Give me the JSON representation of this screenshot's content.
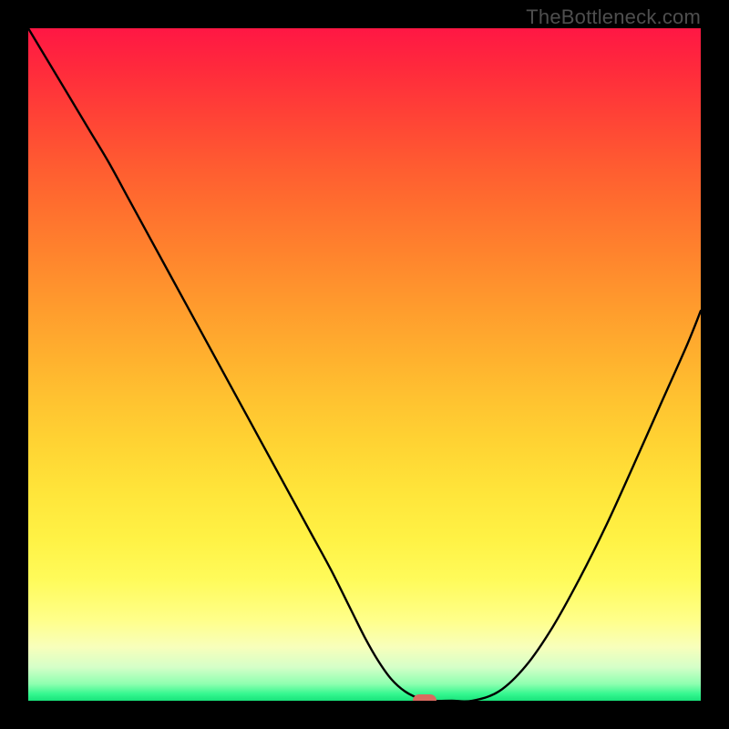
{
  "attribution": "TheBottleneck.com",
  "colors": {
    "background": "#000000",
    "curve_stroke": "#000000",
    "marker_fill": "#d96a5f"
  },
  "chart_data": {
    "type": "line",
    "title": "",
    "xlabel": "",
    "ylabel": "",
    "xlim": [
      0,
      100
    ],
    "ylim": [
      0,
      100
    ],
    "grid": false,
    "legend": false,
    "note": "Axes and tick labels are not shown in the source image; x/y values below are relative to the plot area (0–100). Values are read from the rendered curve.",
    "series": [
      {
        "name": "bottleneck-curve",
        "x": [
          0,
          3,
          6,
          9,
          12,
          15,
          18,
          21,
          24,
          27,
          30,
          33,
          36,
          39,
          42,
          45,
          48,
          50,
          52,
          54,
          56,
          58,
          60,
          63,
          66,
          70,
          74,
          78,
          82,
          86,
          90,
          94,
          98,
          100
        ],
        "y": [
          100,
          95,
          90,
          85,
          80,
          74.5,
          69,
          63.5,
          58,
          52.5,
          47,
          41.5,
          36,
          30.5,
          25,
          19.5,
          13.5,
          9.5,
          6,
          3.2,
          1.4,
          0.4,
          0,
          0,
          0,
          1.4,
          5.2,
          11,
          18.2,
          26.2,
          35,
          44,
          53,
          58
        ]
      }
    ],
    "marker": {
      "x": 59,
      "y": 0,
      "shape": "rounded-rect"
    }
  }
}
